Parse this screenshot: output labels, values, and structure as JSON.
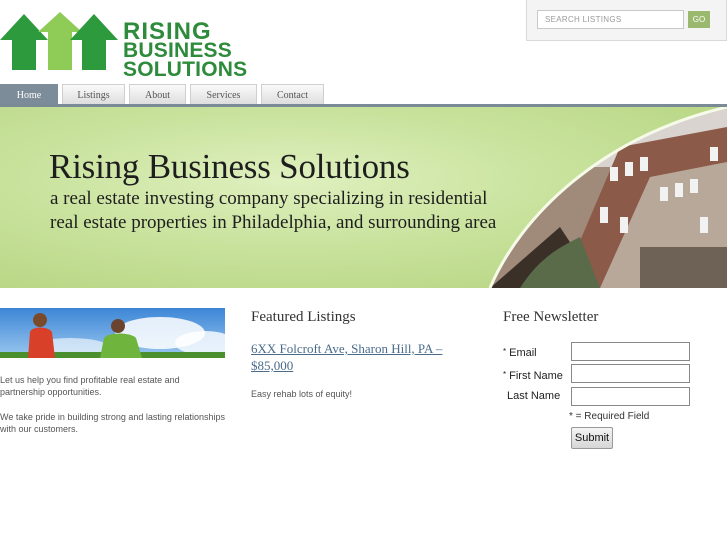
{
  "logo": {
    "line1": "RISING",
    "line2": "BUSINESS",
    "line3": "SOLUTIONS",
    "brand_color": "#2e8b3c"
  },
  "search": {
    "placeholder": "SEARCH LISTINGS",
    "go_label": "GO"
  },
  "nav": {
    "tabs": [
      {
        "label": "Home",
        "active": true
      },
      {
        "label": "Listings"
      },
      {
        "label": "About"
      },
      {
        "label": "Services"
      },
      {
        "label": "Contact"
      }
    ]
  },
  "banner": {
    "title": "Rising Business Solutions",
    "subtitle_line1": "a real estate investing company specializing in residential",
    "subtitle_line2": "real estate properties in Philadelphia, and surrounding area"
  },
  "left_column": {
    "paragraph1": "Let us help you find profitable real estate and partnership opportunities.",
    "paragraph2": "We take pride in building strong and lasting relationships with our customers."
  },
  "featured": {
    "heading": "Featured Listings",
    "listing_link": "6XX Folcroft Ave, Sharon Hill, PA – $85,000",
    "listing_desc": "Easy rehab lots of equity!"
  },
  "newsletter": {
    "heading": "Free Newsletter",
    "email_label": "Email",
    "first_name_label": "First Name",
    "last_name_label": "Last Name",
    "required_marker": "*",
    "required_note": "* = Required Field",
    "submit_label": "Submit"
  }
}
